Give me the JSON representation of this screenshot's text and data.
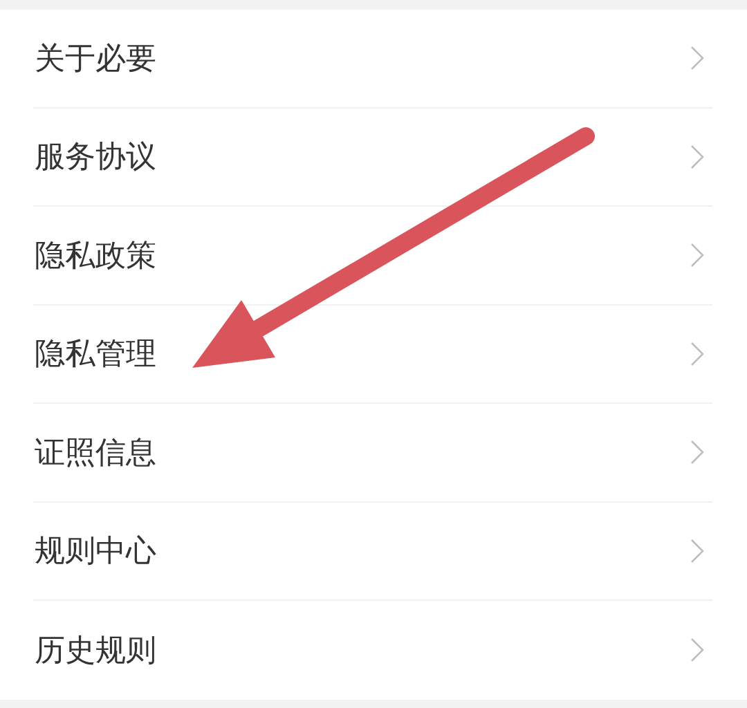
{
  "menu": {
    "items": [
      {
        "label": "关于必要"
      },
      {
        "label": "服务协议"
      },
      {
        "label": "隐私政策"
      },
      {
        "label": "隐私管理"
      },
      {
        "label": "证照信息"
      },
      {
        "label": "规则中心"
      },
      {
        "label": "历史规则"
      }
    ]
  }
}
